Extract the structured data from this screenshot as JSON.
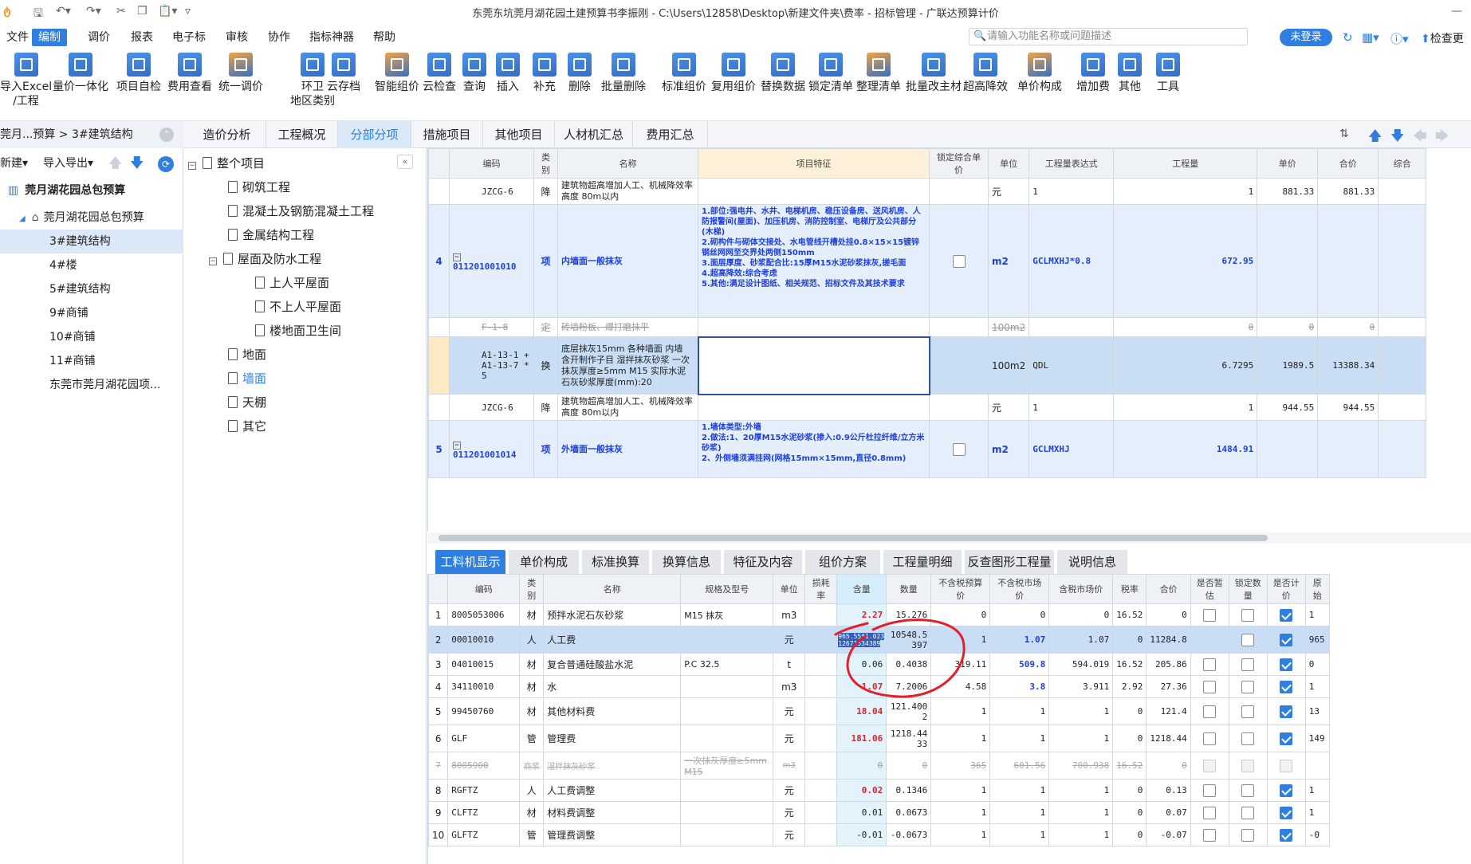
{
  "title": "东莞东坑莞月湖花园土建预算书李振刚 - C:\\Users\\12858\\Desktop\\新建文件夹\\费率 - 招标管理 - 广联达预算计价",
  "menu": [
    "文件",
    "编制",
    "调价",
    "报表",
    "电子标",
    "审核",
    "协作",
    "指标神器",
    "帮助"
  ],
  "search_placeholder": "请输入功能名称或问题描述",
  "login": "未登录",
  "check_update": "检查更",
  "ribbon": [
    {
      "label": "导入Excel",
      "label2": "/工程",
      "icon": "import-icon",
      "color": "#3a86e8"
    },
    {
      "label": "量价一体化",
      "label2": "",
      "icon": "integrate-icon",
      "color": "#2f7fe0"
    },
    {
      "label": "项目自检",
      "label2": "",
      "icon": "check-icon",
      "color": "#3a86e8"
    },
    {
      "label": "费用查看",
      "label2": "",
      "icon": "fee-view-icon",
      "color": "#3a86e8"
    },
    {
      "label": "统一调价",
      "label2": "",
      "icon": "price-adjust-icon",
      "color": "#f29b2b"
    },
    {
      "label": "环卫",
      "label2": "地区类别",
      "icon": "region-icon",
      "color": "#3a86e8"
    },
    {
      "label": "云存档",
      "label2": "",
      "icon": "cloud-save-icon",
      "color": "#3a86e8"
    },
    {
      "label": "智能组价",
      "label2": "",
      "icon": "smart-price-icon",
      "color": "#f29b2b"
    },
    {
      "label": "云检查",
      "label2": "",
      "icon": "cloud-check-icon",
      "color": "#3a86e8"
    },
    {
      "label": "查询",
      "label2": "",
      "icon": "query-icon",
      "color": "#3a86e8"
    },
    {
      "label": "插入",
      "label2": "",
      "icon": "insert-icon",
      "color": "#3a86e8"
    },
    {
      "label": "补充",
      "label2": "",
      "icon": "supplement-icon",
      "color": "#3a86e8"
    },
    {
      "label": "删除",
      "label2": "",
      "icon": "delete-icon",
      "color": "#3a86e8"
    },
    {
      "label": "批量删除",
      "label2": "",
      "icon": "batch-delete-icon",
      "color": "#3a86e8"
    },
    {
      "label": "标准组价",
      "label2": "",
      "icon": "standard-price-icon",
      "color": "#3a86e8"
    },
    {
      "label": "复用组价",
      "label2": "",
      "icon": "reuse-price-icon",
      "color": "#3a86e8"
    },
    {
      "label": "替换数据",
      "label2": "",
      "icon": "replace-icon",
      "color": "#3a86e8"
    },
    {
      "label": "锁定清单",
      "label2": "",
      "icon": "lock-icon",
      "color": "#3a86e8"
    },
    {
      "label": "整理清单",
      "label2": "",
      "icon": "organize-icon",
      "color": "#f29b2b"
    },
    {
      "label": "批量改主材",
      "label2": "",
      "icon": "batch-material-icon",
      "color": "#3a86e8"
    },
    {
      "label": "超高降效",
      "label2": "",
      "icon": "height-icon",
      "color": "#3a86e8"
    },
    {
      "label": "单价构成",
      "label2": "",
      "icon": "unit-price-icon",
      "color": "#f29b2b"
    },
    {
      "label": "增加费",
      "label2": "",
      "icon": "add-fee-icon",
      "color": "#3a86e8"
    },
    {
      "label": "其他",
      "label2": "",
      "icon": "other-icon",
      "color": "#3a86e8"
    },
    {
      "label": "工具",
      "label2": "",
      "icon": "tool-icon",
      "color": "#3a86e8"
    }
  ],
  "left": {
    "breadcrumb": "莞月...预算 > 3#建筑结构",
    "tool_new": "新建",
    "tool_import": "导入导出",
    "tree": [
      {
        "label": "莞月湖花园总包预算",
        "level": 0,
        "icon": "building-icon"
      },
      {
        "label": "莞月湖花园总包预算",
        "level": 1,
        "icon": "home-icon"
      },
      {
        "label": "3#建筑结构",
        "level": 2,
        "sel": true
      },
      {
        "label": "4#楼",
        "level": 2
      },
      {
        "label": "5#建筑结构",
        "level": 2
      },
      {
        "label": "9#商铺",
        "level": 2
      },
      {
        "label": "10#商铺",
        "level": 2
      },
      {
        "label": "11#商铺",
        "level": 2
      },
      {
        "label": "东莞市莞月湖花园项...",
        "level": 2
      }
    ]
  },
  "top_tabs": [
    "造价分析",
    "工程概况",
    "分部分项",
    "措施项目",
    "其他项目",
    "人材机汇总",
    "费用汇总"
  ],
  "mid_tree": [
    {
      "label": "整个项目",
      "level": 0,
      "box": "−"
    },
    {
      "label": "砌筑工程",
      "level": 1
    },
    {
      "label": "混凝土及钢筋混凝土工程",
      "level": 1
    },
    {
      "label": "金属结构工程",
      "level": 1
    },
    {
      "label": "屋面及防水工程",
      "level": 1,
      "box": "−"
    },
    {
      "label": "上人平屋面",
      "level": 2
    },
    {
      "label": "不上人平屋面",
      "level": 2
    },
    {
      "label": "楼地面卫生间",
      "level": 2
    },
    {
      "label": "地面",
      "level": 1
    },
    {
      "label": "墙面",
      "level": 1,
      "sel": true
    },
    {
      "label": "天棚",
      "level": 1
    },
    {
      "label": "其它",
      "level": 1
    }
  ],
  "upper": {
    "headers": [
      "",
      "编码",
      "类别",
      "名称",
      "项目特征",
      "锁定综合单价",
      "单位",
      "工程量表达式",
      "工程量",
      "单价",
      "合价",
      "综合"
    ],
    "rows": [
      {
        "no": "",
        "code": "JZCG-6",
        "cat": "降",
        "name": "建筑物超高增加人工、机械降效率 高度 80m以内",
        "feat": "",
        "lock": "",
        "unit": "元",
        "expr": "1",
        "qty": "1",
        "price": "881.33",
        "total": "881.33",
        "cls": ""
      },
      {
        "no": "4",
        "code": "011201001010",
        "cat": "项",
        "name": "内墙面一般抹灰",
        "feat": "1.部位:强电井、水井、电梯机房、稳压设备房、送风机房、人防报警间(屋面)、加压机房、消防控制室、电梯厅及公共部分(木梯)\n2.砌构件与砌体交接处、水电管线开槽处挂0.8×15×15镀锌钢丝网网至交界处两侧150mm\n3.面层厚度、砂浆配合比:15厚M15水泥砂浆抹灰,搓毛面\n4.超高降效:综合考虑\n5.其他:满足设计图纸、相关规范、招标文件及其技术要求",
        "lock": "box",
        "unit": "m2",
        "expr": "GCLMXHJ*0.8",
        "qty": "672.95",
        "price": "",
        "total": "",
        "cls": "blue"
      },
      {
        "no": "",
        "code": "F-1-8",
        "cat": "定",
        "name": "砖墙粉板、爆打磨抹平",
        "feat": "",
        "lock": "",
        "unit": "100m2",
        "expr": "",
        "qty": "0",
        "price": "0",
        "total": "0",
        "cls": "strike"
      },
      {
        "no": "",
        "code": "A1-13-1 + A1-13-7 * 5",
        "cat": "换",
        "name": "底层抹灰15mm 各种墙面 内墙 含开制作子目 湿拌抹灰砂浆 一次抹灰厚度≥5mm M15 实际水泥石灰砂浆厚度(mm):20",
        "feat": "",
        "lock": "",
        "unit": "100m2",
        "expr": "QDL",
        "qty": "6.7295",
        "price": "1989.5",
        "total": "13388.34",
        "cls": "sel"
      },
      {
        "no": "",
        "code": "JZCG-6",
        "cat": "降",
        "name": "建筑物超高增加人工、机械降效率 高度 80m以内",
        "feat": "",
        "lock": "",
        "unit": "元",
        "expr": "1",
        "qty": "1",
        "price": "944.55",
        "total": "944.55",
        "cls": ""
      },
      {
        "no": "5",
        "code": "011201001014",
        "cat": "项",
        "name": "外墙面一般抹灰",
        "feat": "1.墙体类型:外墙\n2.做法:1、20厚M15水泥砂浆(掺入:0.9公斤杜拉纤维/立方米砂浆)\n2、外侧墙须满挂网(网格15mm×15mm,直径0.8mm)",
        "lock": "box",
        "unit": "m2",
        "expr": "GCLMXHJ",
        "qty": "1484.91",
        "price": "",
        "total": "",
        "cls": "blue"
      }
    ]
  },
  "bottom_tabs": [
    "工料机显示",
    "单价构成",
    "标准换算",
    "换算信息",
    "特征及内容",
    "组价方案",
    "工程量明细",
    "反查图形工程量",
    "说明信息"
  ],
  "lower": {
    "headers": [
      "",
      "编码",
      "类别",
      "名称",
      "规格及型号",
      "单位",
      "损耗率",
      "含量",
      "数量",
      "不含税预算价",
      "不含税市场价",
      "含税市场价",
      "税率",
      "合价",
      "是否暂估",
      "锁定数量",
      "是否计价",
      "原始"
    ],
    "rows": [
      {
        "no": "1",
        "code": "8005053006",
        "cat": "材",
        "name": "预拌水泥石灰砂浆",
        "spec": "M15 抹灰",
        "unit": "m3",
        "loss": "",
        "qty": "2.27",
        "qtycls": "red",
        "amt": "15.276",
        "p1": "0",
        "p2": "0",
        "p3": "0",
        "tax": "16.52",
        "total": "0",
        "est": "box",
        "lockq": "box",
        "calc": "on",
        "orig": "1"
      },
      {
        "no": "2",
        "code": "00010010",
        "cat": "人",
        "name": "人工费",
        "spec": "",
        "unit": "元",
        "loss": "",
        "qty": "965.55*1.02312671534389",
        "qtycls": "edit",
        "amt": "10548.5397",
        "p1": "1",
        "p2": "1.07",
        "p2cls": "blue",
        "p3": "1.07",
        "tax": "0",
        "total": "11284.8",
        "est": "",
        "lockq": "box",
        "calc": "on",
        "orig": "965",
        "sel": true
      },
      {
        "no": "3",
        "code": "04010015",
        "cat": "材",
        "name": "复合普通硅酸盐水泥",
        "spec": "P.C 32.5",
        "unit": "t",
        "loss": "",
        "qty": "0.06",
        "qtycls": "",
        "amt": "0.4038",
        "p1": "319.11",
        "p2": "509.8",
        "p2cls": "blue",
        "p3": "594.019",
        "tax": "16.52",
        "total": "205.86",
        "est": "box",
        "lockq": "box",
        "calc": "on",
        "orig": "0"
      },
      {
        "no": "4",
        "code": "34110010",
        "cat": "材",
        "name": "水",
        "spec": "",
        "unit": "m3",
        "loss": "",
        "qty": "1.07",
        "qtycls": "red",
        "amt": "7.2006",
        "p1": "4.58",
        "p2": "3.8",
        "p2cls": "blue",
        "p3": "3.911",
        "tax": "2.92",
        "total": "27.36",
        "est": "box",
        "lockq": "box",
        "calc": "on",
        "orig": "1"
      },
      {
        "no": "5",
        "code": "99450760",
        "cat": "材",
        "name": "其他材料费",
        "spec": "",
        "unit": "元",
        "loss": "",
        "qty": "18.04",
        "qtycls": "red",
        "amt": "121.4002",
        "p1": "1",
        "p2": "1",
        "p3": "1",
        "tax": "0",
        "total": "121.4",
        "est": "box",
        "lockq": "box",
        "calc": "on",
        "orig": "13"
      },
      {
        "no": "6",
        "code": "GLF",
        "cat": "管",
        "name": "管理费",
        "spec": "",
        "unit": "元",
        "loss": "",
        "qty": "181.06",
        "qtycls": "red",
        "amt": "1218.4433",
        "p1": "1",
        "p2": "1",
        "p3": "1",
        "tax": "0",
        "total": "1218.44",
        "est": "box",
        "lockq": "box",
        "calc": "on",
        "orig": "149"
      },
      {
        "no": "7",
        "code": "8005900",
        "cat": "商浆",
        "name": "湿拌抹灰砂浆",
        "spec": "一次抹灰厚度≥5mm M15",
        "unit": "m3",
        "loss": "",
        "qty": "0",
        "qtycls": "",
        "amt": "0",
        "p1": "365",
        "p2": "601.56",
        "p3": "700.938",
        "tax": "16.52",
        "total": "0",
        "est": "dis",
        "lockq": "dis",
        "calc": "dis",
        "orig": "",
        "strike": true
      },
      {
        "no": "8",
        "code": "RGFTZ",
        "cat": "人",
        "name": "人工费调整",
        "spec": "",
        "unit": "元",
        "loss": "",
        "qty": "0.02",
        "qtycls": "red",
        "amt": "0.1346",
        "p1": "1",
        "p2": "1",
        "p3": "1",
        "tax": "0",
        "total": "0.13",
        "est": "box",
        "lockq": "box",
        "calc": "on",
        "orig": "1"
      },
      {
        "no": "9",
        "code": "CLFTZ",
        "cat": "材",
        "name": "材料费调整",
        "spec": "",
        "unit": "元",
        "loss": "",
        "qty": "0.01",
        "qtycls": "",
        "amt": "0.0673",
        "p1": "1",
        "p2": "1",
        "p3": "1",
        "tax": "0",
        "total": "0.07",
        "est": "box",
        "lockq": "box",
        "calc": "on",
        "orig": "1"
      },
      {
        "no": "10",
        "code": "GLFTZ",
        "cat": "管",
        "name": "管理费调整",
        "spec": "",
        "unit": "元",
        "loss": "",
        "qty": "-0.01",
        "qtycls": "",
        "amt": "-0.0673",
        "p1": "1",
        "p2": "1",
        "p3": "1",
        "tax": "0",
        "total": "-0.07",
        "est": "box",
        "lockq": "box",
        "calc": "on",
        "orig": "-0"
      }
    ]
  },
  "colors": {
    "accent": "#2f7fe0",
    "annotation": "#e0202a",
    "selected_row": "#c9ddf4"
  }
}
